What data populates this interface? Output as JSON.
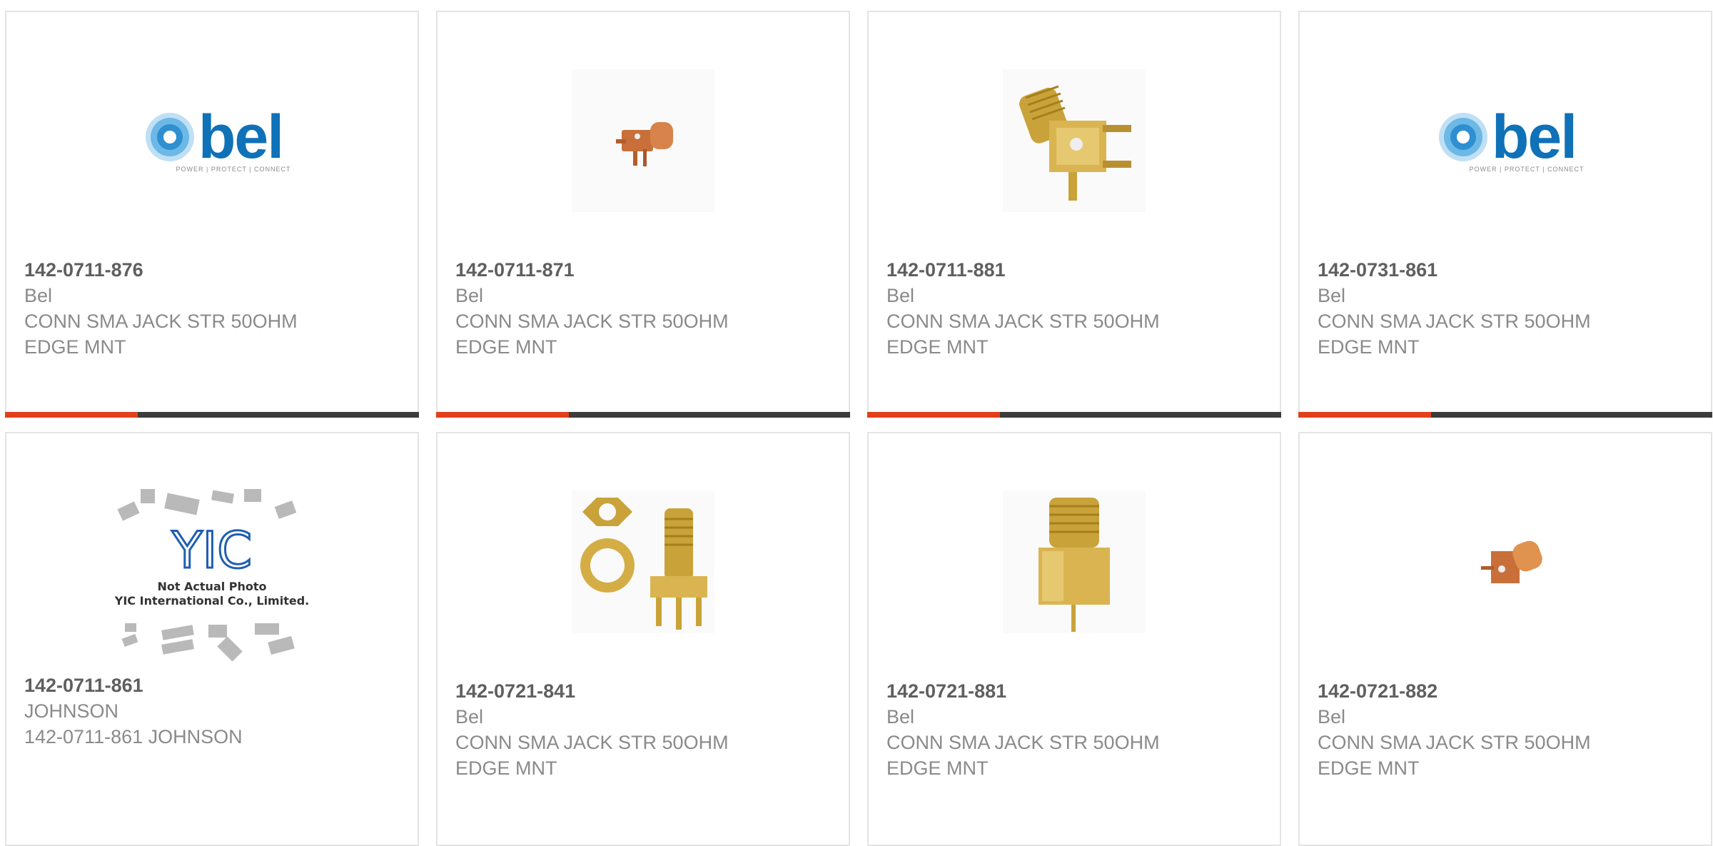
{
  "products": [
    {
      "part_number": "142-0711-876",
      "manufacturer": "Bel",
      "description": "CONN SMA JACK STR 50OHM EDGE MNT",
      "image": "bel-logo",
      "progress": 0.32
    },
    {
      "part_number": "142-0711-871",
      "manufacturer": "Bel",
      "description": "CONN SMA JACK STR 50OHM EDGE MNT",
      "image": "small-copper-connector",
      "progress": 0.32
    },
    {
      "part_number": "142-0711-881",
      "manufacturer": "Bel",
      "description": "CONN SMA JACK STR 50OHM EDGE MNT",
      "image": "gold-right-angle-sma",
      "progress": 0.32
    },
    {
      "part_number": "142-0731-861",
      "manufacturer": "Bel",
      "description": "CONN SMA JACK STR 50OHM EDGE MNT",
      "image": "bel-logo",
      "progress": 0.32
    },
    {
      "part_number": "142-0711-861",
      "manufacturer": "JOHNSON",
      "description": "142-0711-861 JOHNSON",
      "image": "yic-placeholder",
      "image_text": {
        "brand": "YIC",
        "line1": "Not Actual Photo",
        "line2": "YIC International Co., Limited."
      }
    },
    {
      "part_number": "142-0721-841",
      "manufacturer": "Bel",
      "description": "CONN SMA JACK STR 50OHM EDGE MNT",
      "image": "gold-sma-with-nut"
    },
    {
      "part_number": "142-0721-881",
      "manufacturer": "Bel",
      "description": "CONN SMA JACK STR 50OHM EDGE MNT",
      "image": "gold-vertical-sma"
    },
    {
      "part_number": "142-0721-882",
      "manufacturer": "Bel",
      "description": "CONN SMA JACK STR 50OHM EDGE MNT",
      "image": "small-copper-connector"
    }
  ],
  "logo": {
    "word": "bel",
    "tagline": "POWER | PROTECT | CONNECT"
  },
  "colors": {
    "progress_fill": "#e2401c",
    "progress_track": "#3c3c3c",
    "bel_blue": "#0f71b8",
    "gold": "#c9a23a",
    "copper": "#c86f3a"
  }
}
